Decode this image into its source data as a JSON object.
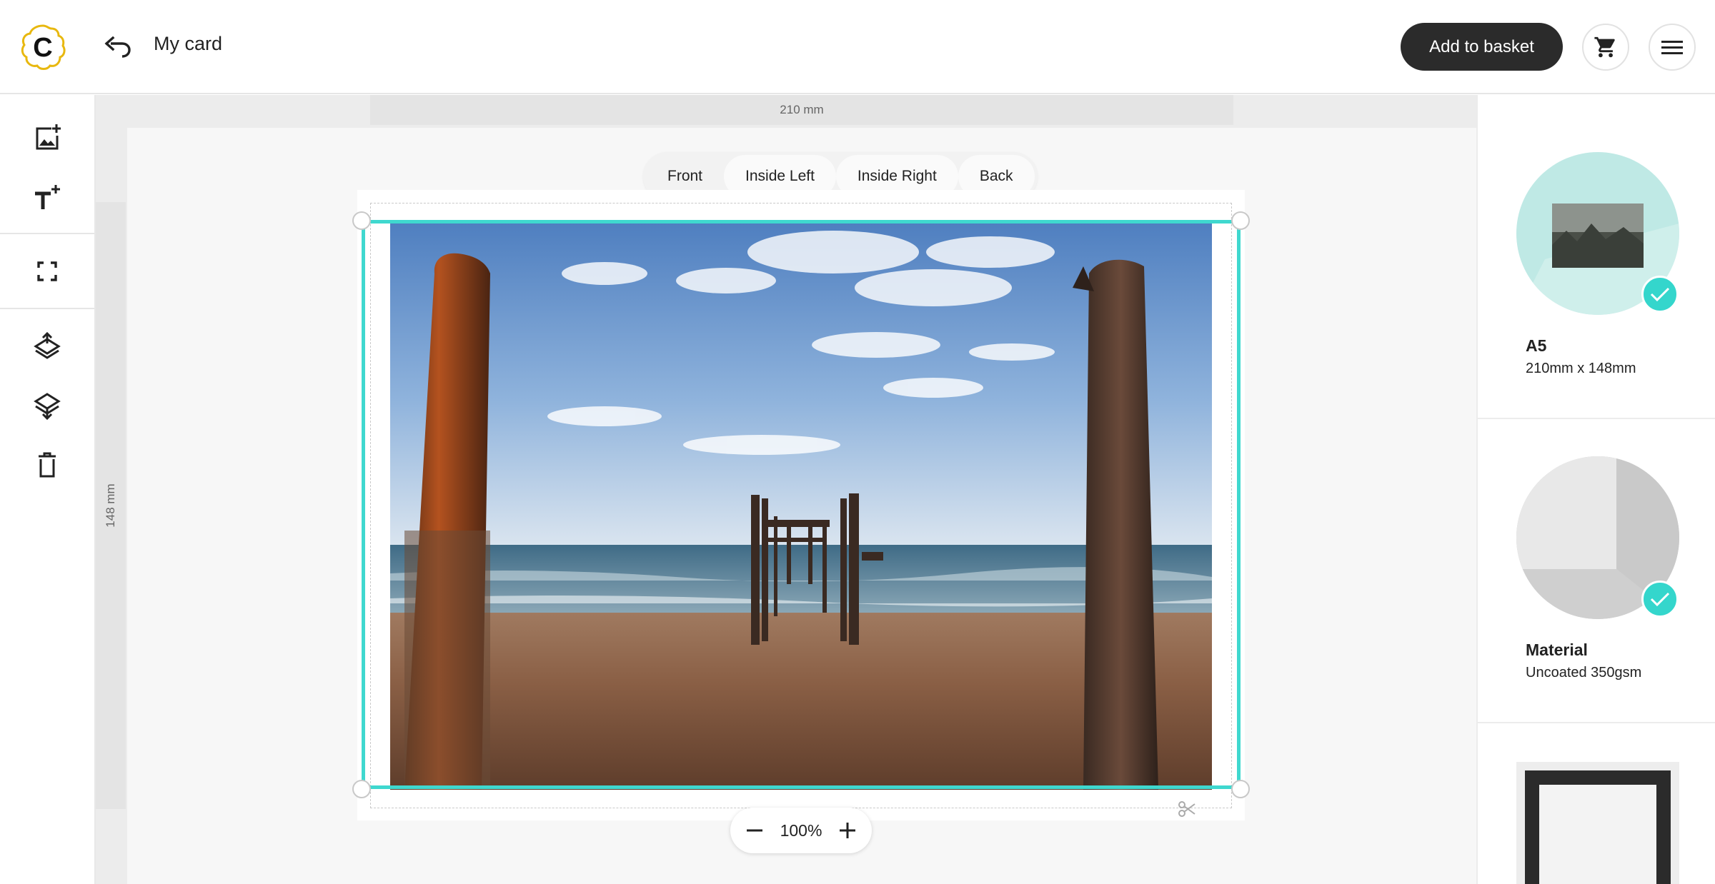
{
  "header": {
    "title": "My card",
    "add_to_basket": "Add to basket",
    "logo_letter": "C"
  },
  "canvas": {
    "width_ruler": "210 mm",
    "height_ruler": "148 mm",
    "tabs": [
      {
        "label": "Front",
        "selected": true
      },
      {
        "label": "Inside Left",
        "selected": false
      },
      {
        "label": "Inside Right",
        "selected": false
      },
      {
        "label": "Back",
        "selected": false
      }
    ],
    "zoom": "100%"
  },
  "right_panel": {
    "options": [
      {
        "title": "A5",
        "subtitle": "210mm x 148mm",
        "selected": true
      },
      {
        "title": "Material",
        "subtitle": "Uncoated 350gsm",
        "selected": true
      }
    ]
  },
  "colors": {
    "accent": "#3fd8cf",
    "check": "#34d6cc",
    "primary_button": "#2b2b2b",
    "logo": "#f2c12e"
  },
  "icons": {
    "toolbar": [
      "add-image-icon",
      "add-text-icon",
      "fit-to-page-icon",
      "bring-forward-icon",
      "send-backward-icon",
      "delete-icon"
    ],
    "header": [
      "undo-icon",
      "cart-icon",
      "menu-icon"
    ]
  }
}
